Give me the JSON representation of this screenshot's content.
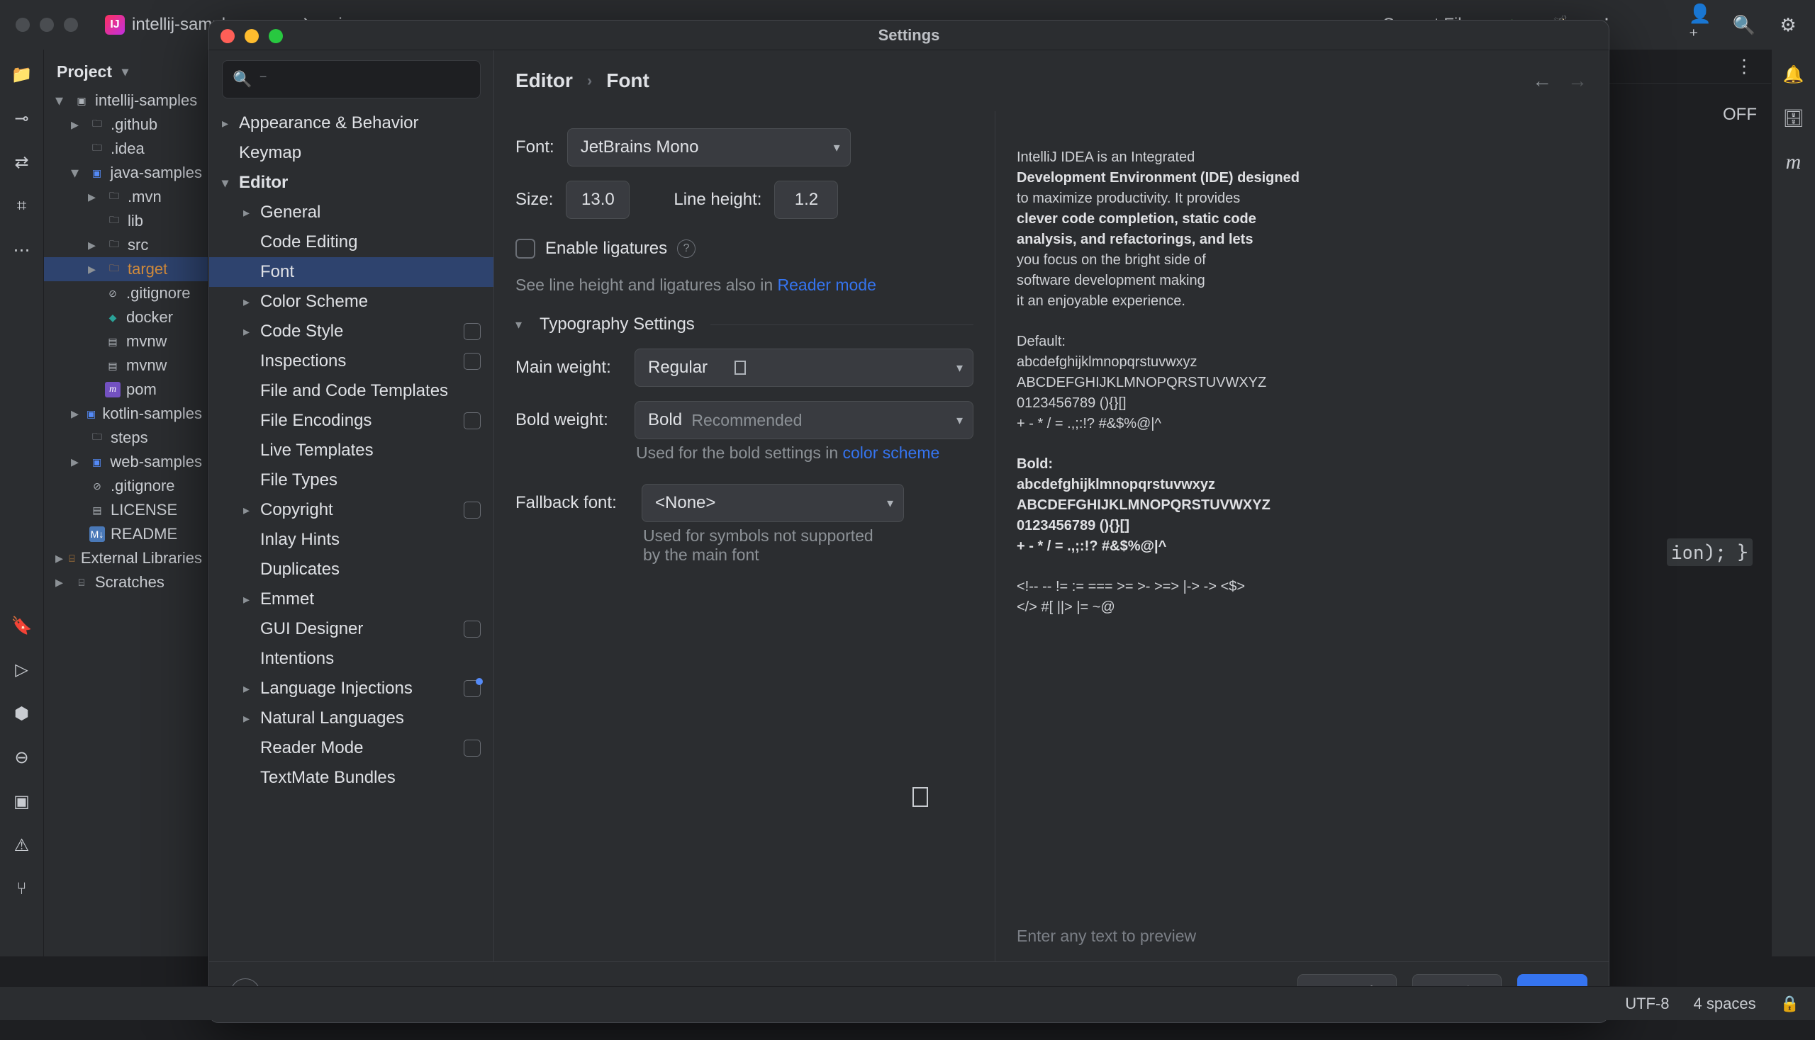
{
  "topbar": {
    "project": "intellij-samples",
    "branch": "main",
    "run_config": "Current File"
  },
  "project_tree": {
    "header": "Project",
    "root": "intellij-samples",
    "items": {
      "github": ".github",
      "idea": ".idea",
      "javasamples": "java-samples",
      "mvn": ".mvn",
      "lib": "lib",
      "src": "src",
      "target": "target",
      "gitignore_inner": ".gitignore",
      "docker": "docker",
      "mvnw": "mvnw",
      "mvnwcmd": "mvnw",
      "pom": "pom",
      "kotlin": "kotlin-samples",
      "steps": "steps",
      "web": "web-samples",
      "gitignore": ".gitignore",
      "license": "LICENSE",
      "readme": "README",
      "external": "External Libraries",
      "scratches": "Scratches"
    }
  },
  "editor_peek": {
    "off": "OFF",
    "code": "ion); }"
  },
  "settings": {
    "title": "Settings",
    "search_placeholder": "",
    "nav": {
      "appearance": "Appearance & Behavior",
      "keymap": "Keymap",
      "editor": "Editor",
      "general": "General",
      "codeediting": "Code Editing",
      "font": "Font",
      "colorscheme": "Color Scheme",
      "codestyle": "Code Style",
      "inspections": "Inspections",
      "filecodetmpl": "File and Code Templates",
      "fileenc": "File Encodings",
      "livetmpl": "Live Templates",
      "filetypes": "File Types",
      "copyright": "Copyright",
      "inlayhints": "Inlay Hints",
      "duplicates": "Duplicates",
      "emmet": "Emmet",
      "guidesigner": "GUI Designer",
      "intentions": "Intentions",
      "langinj": "Language Injections",
      "naturallang": "Natural Languages",
      "readermode": "Reader Mode",
      "textmate": "TextMate Bundles"
    },
    "breadcrumb": {
      "a": "Editor",
      "b": "Font"
    },
    "form": {
      "font_label": "Font:",
      "font_value": "JetBrains Mono",
      "size_label": "Size:",
      "size_value": "13.0",
      "lineheight_label": "Line height:",
      "lineheight_value": "1.2",
      "ligatures": "Enable ligatures",
      "readerhint_a": "See line height and ligatures also in ",
      "readerhint_link": "Reader mode",
      "typo_header": "Typography Settings",
      "mainweight_label": "Main weight:",
      "mainweight_value": "Regular",
      "boldweight_label": "Bold weight:",
      "boldweight_value": "Bold",
      "boldweight_rec": "Recommended",
      "boldhint_a": "Used for the bold settings in ",
      "boldhint_link": "color scheme",
      "fallback_label": "Fallback font:",
      "fallback_value": "<None>",
      "fallback_hint_a": "Used for symbols not supported",
      "fallback_hint_b": "by the main font"
    },
    "preview": {
      "l1": "IntelliJ IDEA is an Integrated",
      "l2": "Development Environment (IDE) designed",
      "l3": "to maximize productivity. It provides",
      "l4": "clever code completion, static code",
      "l5": "analysis, and refactorings, and lets",
      "l6": "you focus on the bright side of",
      "l7": "software development making",
      "l8": "it an enjoyable experience.",
      "d_hdr": "Default:",
      "d1": "abcdefghijklmnopqrstuvwxyz",
      "d2": "ABCDEFGHIJKLMNOPQRSTUVWXYZ",
      "d3": "0123456789 (){}[]",
      "d4": "+ - * / = .,;:!? #&$%@|^",
      "b_hdr": "Bold:",
      "s1": "<!-- -- != := === >= >- >=> |-> -> <$>",
      "s2": "</> #[ ||> |= ~@",
      "input_ph": "Enter any text to preview"
    },
    "footer": {
      "cancel": "Cancel",
      "apply": "Apply",
      "ok": "OK"
    }
  },
  "statusbar": {
    "encoding": "UTF-8",
    "indent": "4 spaces"
  },
  "colors": {
    "accent": "#3574f0",
    "bg": "#2b2d30",
    "panel": "#1e1f22"
  }
}
